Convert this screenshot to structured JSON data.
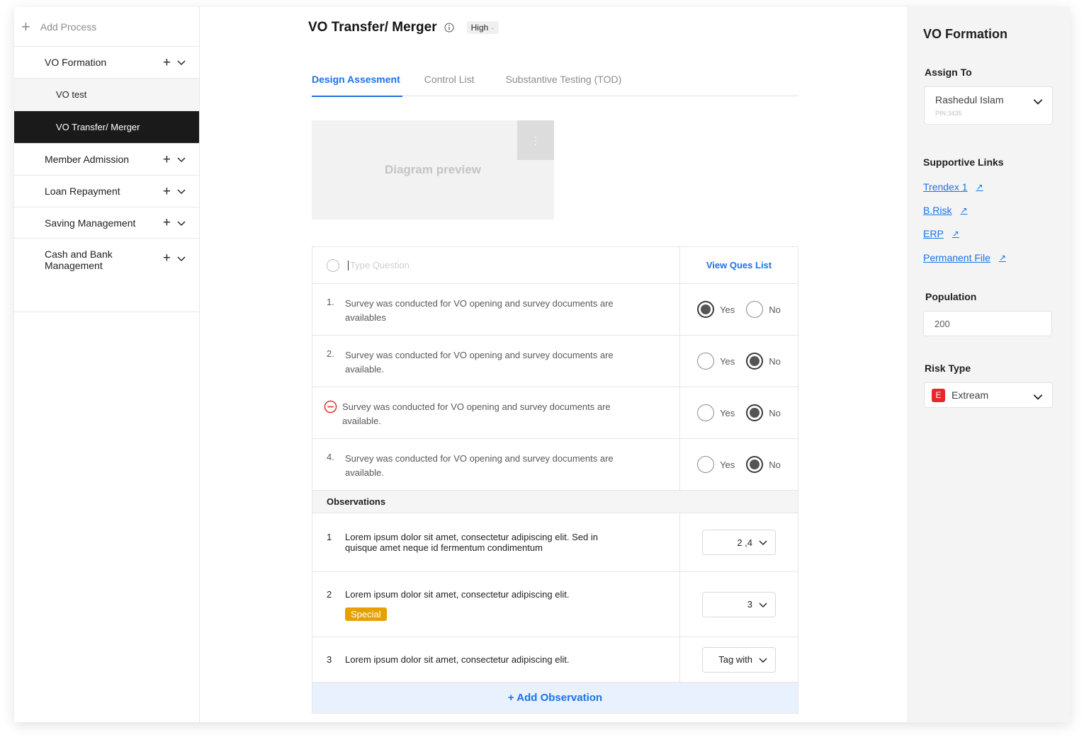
{
  "sidebar": {
    "add_process": "Add Process",
    "items": [
      {
        "label": "VO Formation"
      },
      {
        "label": "Member Admission"
      },
      {
        "label": "Loan Repayment"
      },
      {
        "label": "Saving Management"
      },
      {
        "label": "Cash and Bank Management"
      }
    ],
    "sub_items": [
      {
        "label": "VO test",
        "active": false
      },
      {
        "label": "VO Transfer/ Merger",
        "active": true
      }
    ]
  },
  "header": {
    "title": "VO Transfer/ Merger",
    "priority": "High"
  },
  "tabs": [
    {
      "label": "Design Assesment",
      "active": true
    },
    {
      "label": "Control List",
      "active": false
    },
    {
      "label": "Substantive Testing (TOD)",
      "active": false
    }
  ],
  "diagram": {
    "label": "Diagram preview"
  },
  "questions": {
    "placeholder": "Type Question",
    "view_list_label": "View Ques List",
    "items": [
      {
        "num": "1.",
        "text": "Survey was conducted for VO opening and survey documents are availables",
        "answer": "Yes"
      },
      {
        "num": "2.",
        "text": "Survey was conducted for VO opening and survey documents are available.",
        "answer": "No"
      },
      {
        "num": "",
        "text": "Survey was conducted for VO opening and survey documents are available.",
        "answer": "No",
        "removable": true
      },
      {
        "num": "4.",
        "text": "Survey was conducted for VO opening and survey documents are available.",
        "answer": "No"
      }
    ],
    "yes_label": "Yes",
    "no_label": "No"
  },
  "observations": {
    "heading": "Observations",
    "items": [
      {
        "num": "1",
        "text": "Lorem ipsum dolor sit amet, consectetur adipiscing elit. Sed in quisque amet neque id fermentum condimentum",
        "tag": "2 ,4"
      },
      {
        "num": "2",
        "text": "Lorem ipsum dolor sit amet, consectetur adipiscing elit.",
        "tag": "3",
        "badge": "Special"
      },
      {
        "num": "3",
        "text": "Lorem ipsum dolor sit amet, consectetur adipiscing elit.",
        "tag": "Tag with"
      }
    ],
    "add_label": "+ Add Observation"
  },
  "right_panel": {
    "title": "VO Formation",
    "assign_label": "Assign To",
    "assignee_name": "Rashedul Islam",
    "assignee_pin": "PIN:3435",
    "links_label": "Supportive Links",
    "links": [
      "Trendex 1",
      "B.Risk",
      "ERP",
      "Permanent File"
    ],
    "population_label": "Population",
    "population_value": "200",
    "risk_label": "Risk Type",
    "risk_badge": "E",
    "risk_value": "Extream"
  },
  "colors": {
    "accent": "#1a73e8",
    "active_nav_bg": "#1a1a1a",
    "special_badge": "#e6a100",
    "risk_badge": "#e8262b",
    "remove_icon": "#e02424"
  }
}
